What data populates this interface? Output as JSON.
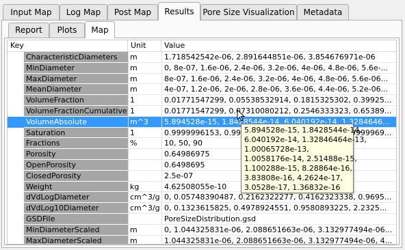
{
  "tabs": [
    "Input Map",
    "Log Map",
    "Post Map",
    "Results",
    "Pore Size Visualization",
    "Metadata"
  ],
  "active_tab": "Results",
  "subtabs": [
    "Report",
    "Plots",
    "Map"
  ],
  "active_subtab": "Map",
  "table": {
    "headers": [
      "Key",
      "Unit",
      "Value"
    ],
    "rows": [
      {
        "key": "CharacteristicDiameters",
        "unit": "m",
        "value": "1.718542542e-06, 2.891644851e-06, 3.854676971e-06"
      },
      {
        "key": "MinDiameter",
        "unit": "m",
        "value": "0, 8e-07, 1.6e-06, 2.4e-06, 3.2e-06, 4e-06, 4.8e-06, 5.6e-..."
      },
      {
        "key": "MaxDiameter",
        "unit": "m",
        "value": "8e-07, 1.6e-06, 2.4e-06, 3.2e-06, 4e-06, 4.8e-06, 5.6e-06..."
      },
      {
        "key": "MeanDiameter",
        "unit": "m",
        "value": "4e-07, 1.2e-06, 2e-06, 2.8e-06, 3.6e-06, 4.4e-06, 5.2e-06..."
      },
      {
        "key": "VolumeFraction",
        "unit": "1",
        "value": "0.01771547299, 0.05538532914, 0.1815325302, 0.39925..."
      },
      {
        "key": "VolumeFractionCumulative",
        "unit": "1",
        "value": "0.01771547299, 0.07310080212, 0.2546333323, 0.65389..."
      },
      {
        "key": "VolumeAbsolute",
        "unit": "m^3",
        "value": "5.894528e-15, 1.8428544e-14, 6.040192e-14, 1.3284646...",
        "selected": true
      },
      {
        "key": "Saturation",
        "unit": "1",
        "value": "0.9999996153, 0.9999911433, 0.9999993133, 0.9999969..."
      },
      {
        "key": "Fractions",
        "unit": "%",
        "value": "10, 50, 90"
      },
      {
        "key": "Porosity",
        "unit": "",
        "value": "0.64986975"
      },
      {
        "key": "OpenPorosity",
        "unit": "",
        "value": "0.6498695"
      },
      {
        "key": "ClosedPorosity",
        "unit": "",
        "value": "2.5e-07"
      },
      {
        "key": "Weight",
        "unit": "kg",
        "value": "4.62508055e-10"
      },
      {
        "key": "dVdLogDiameter",
        "unit": "cm^3/g",
        "value": "0, 0.05748390487, 0.2162322277, 0.4162323338, 0.9695..."
      },
      {
        "key": "dVdLog10Diameter",
        "unit": "cm^3/g",
        "value": "0, 0.1323615825, 0.4978924551, 0.9580893225, 2.2325..."
      },
      {
        "key": "GSDFile",
        "unit": "",
        "value": "PoreSizeDistribution.gsd"
      },
      {
        "key": "MinDiameterScaled",
        "unit": "m",
        "value": "0, 1.044325831e-06, 2.088651663e-06, 3.132977494e-06..."
      },
      {
        "key": "MaxDiameterScaled",
        "unit": "m",
        "value": "1.044325831e-06, 2.088651663e-06, 3.132977494e-06, 4..."
      }
    ]
  },
  "tooltip": "5.894528e-15, 1.8428544e-14,\n6.040192e-14, 1.32846464e-13,\n1.00065728e-13,\n1.0058176e-14, 2.51488e-15,\n1.100288e-15, 8.28864e-16,\n3.83808e-16, 4.2624e-17,\n3.0528e-17, 1.36832e-16"
}
